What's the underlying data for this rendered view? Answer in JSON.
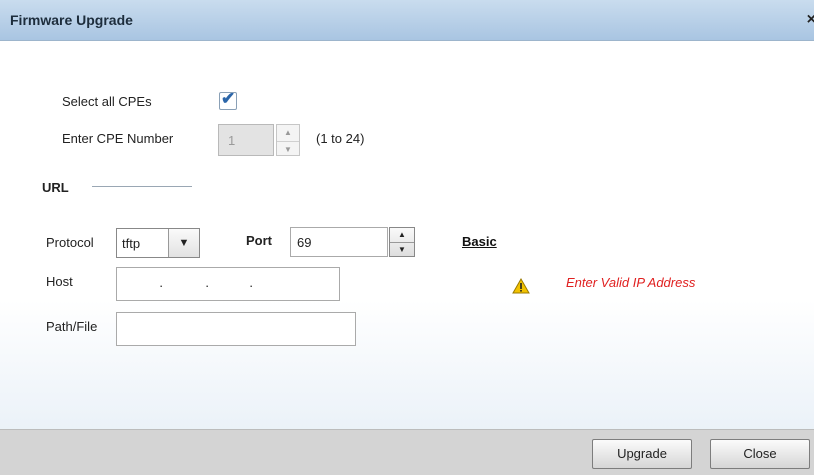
{
  "dialog": {
    "title": "Firmware Upgrade",
    "close_glyph": "×"
  },
  "cpe": {
    "select_all_label": "Select all CPEs",
    "select_all_checked": true,
    "number_label": "Enter CPE Number",
    "number_value": "1",
    "number_range": "(1 to 24)"
  },
  "url": {
    "section_label": "URL",
    "protocol_label": "Protocol",
    "protocol_value": "tftp",
    "port_label": "Port",
    "port_value": "69",
    "basic_link": "Basic",
    "host_label": "Host",
    "host_value": "",
    "path_label": "Path/File",
    "path_value": "",
    "error_text": "Enter Valid IP Address"
  },
  "icons": {
    "checkbox": "check-icon",
    "warning": "warning-icon",
    "dropdown": "chevron-down-icon",
    "spin_up": "spin-up-icon",
    "spin_down": "spin-down-icon"
  },
  "colors": {
    "titlebar": "#b6cfe8",
    "error": "#e02020",
    "warning": "#f2c200"
  },
  "footer": {
    "upgrade_label": "Upgrade",
    "close_label": "Close"
  }
}
